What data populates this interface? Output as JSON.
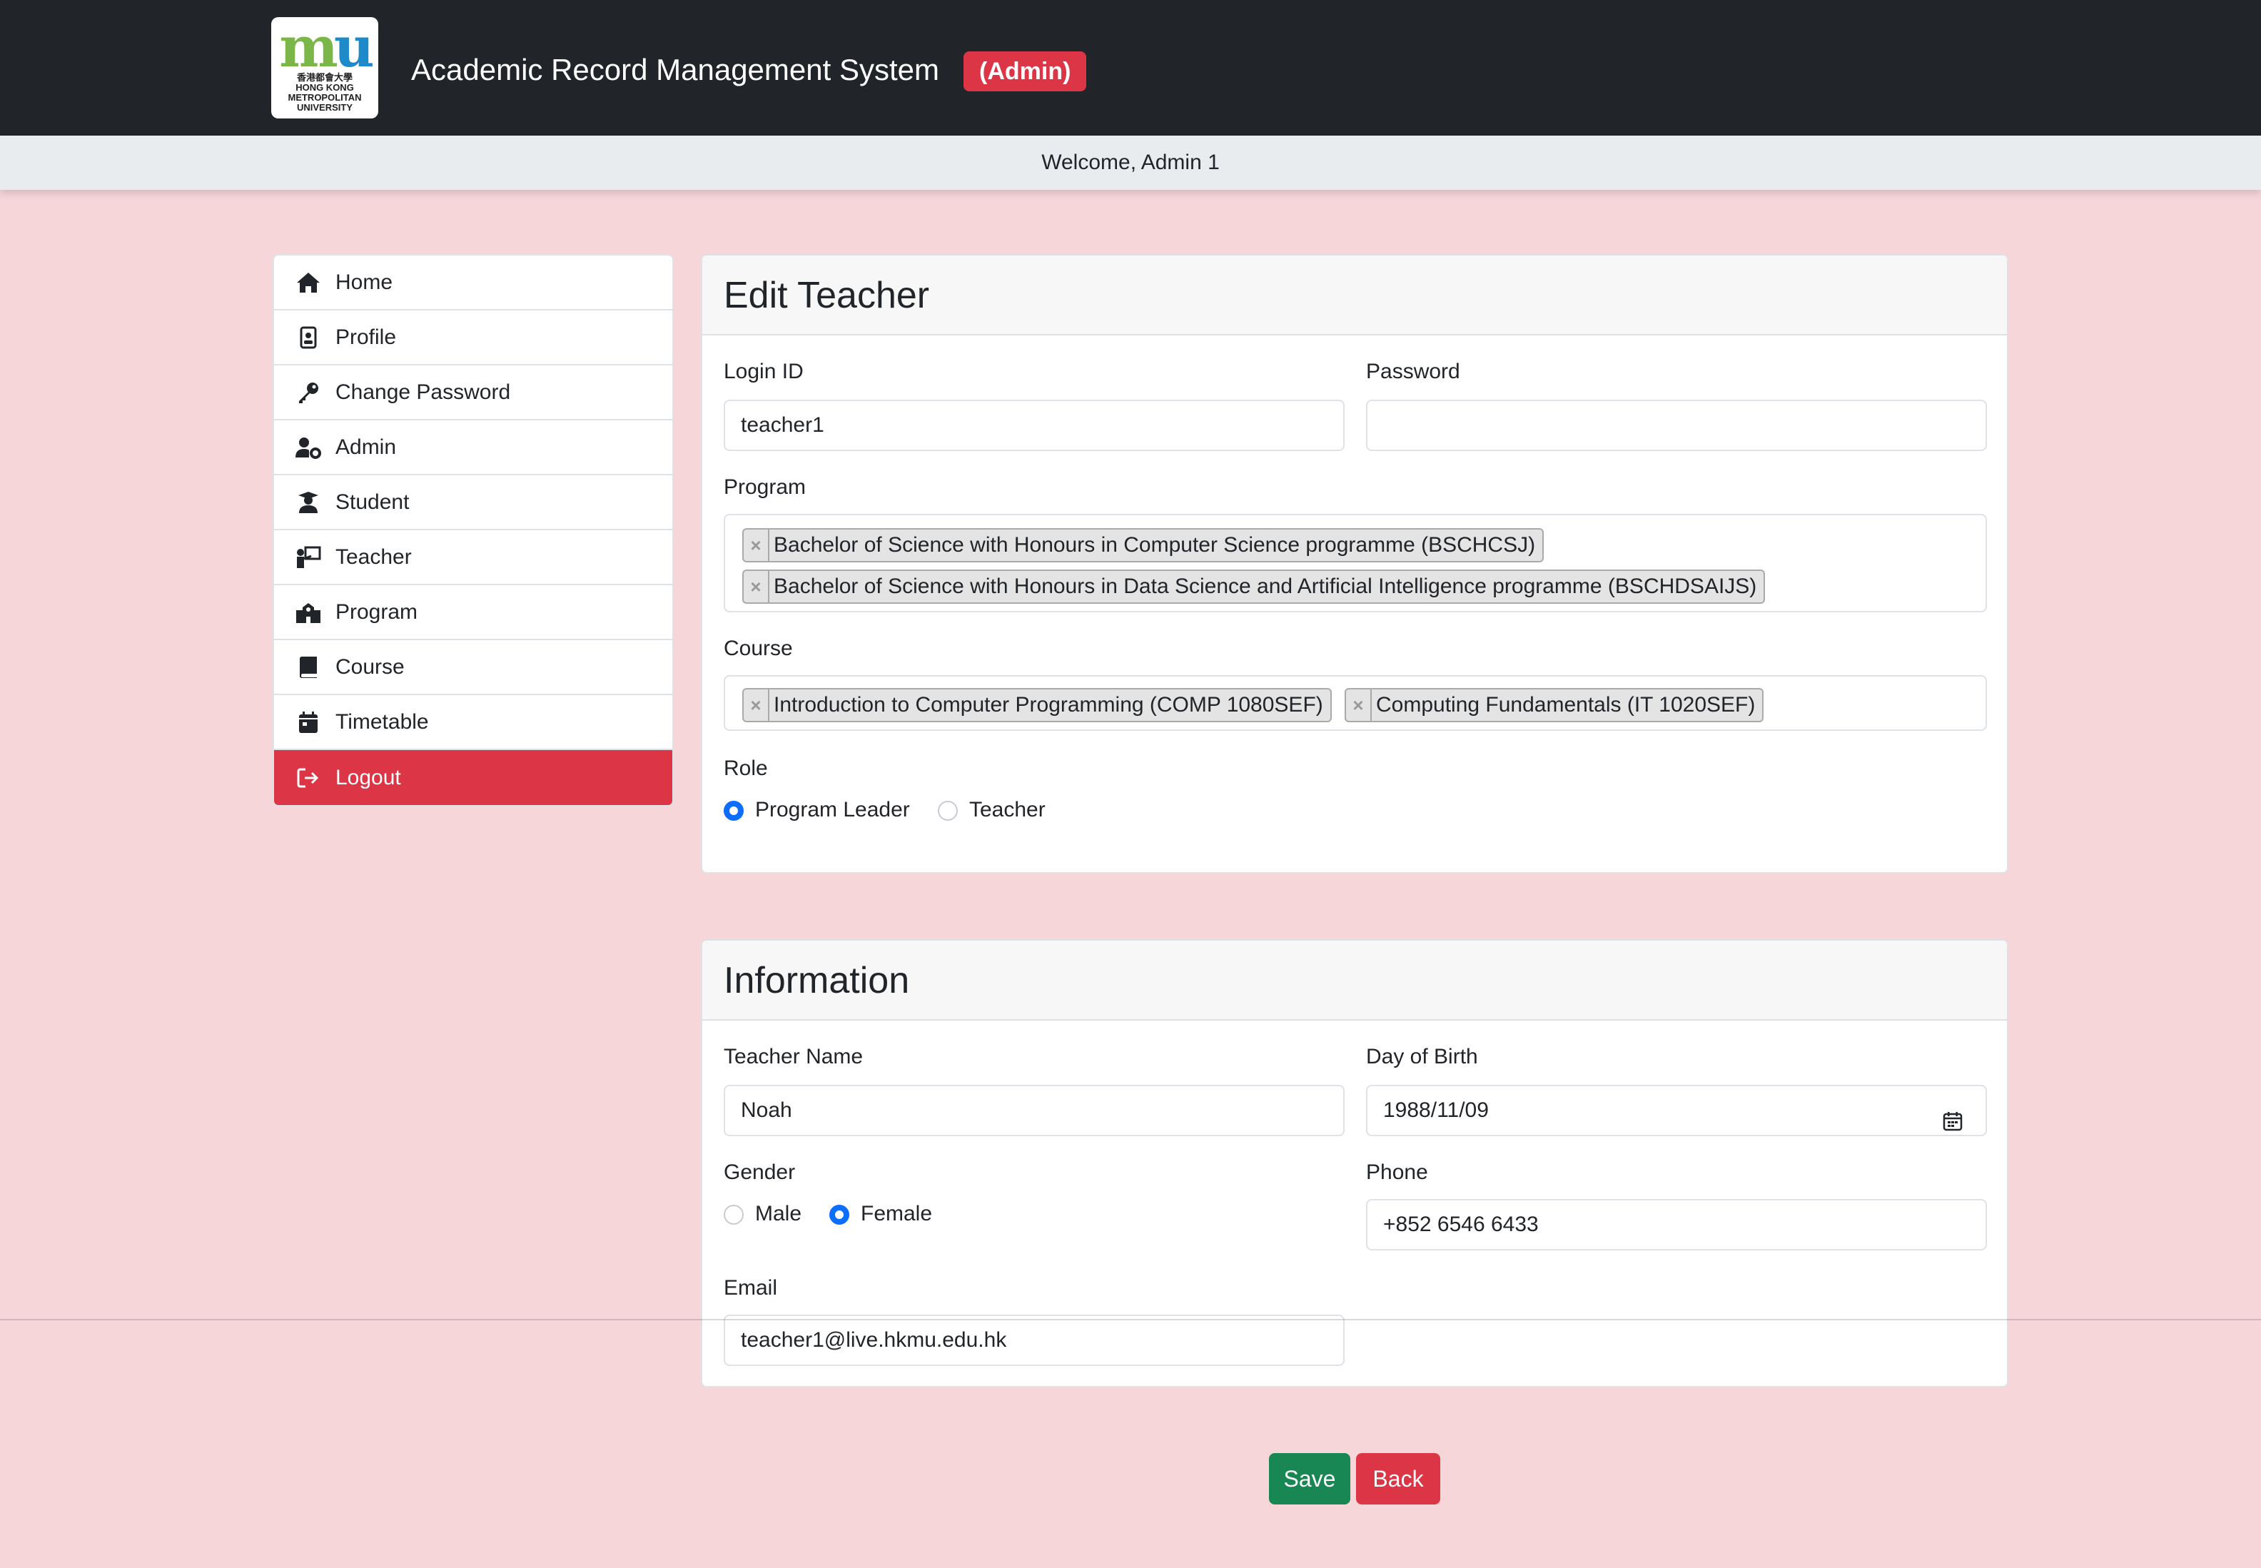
{
  "header": {
    "logo_mark_m": "m",
    "logo_mark_u": "u",
    "logo_lines": [
      "香港都會大學",
      "HONG KONG",
      "METROPOLITAN",
      "UNIVERSITY"
    ],
    "app_title": "Academic Record Management System",
    "role_badge": "(Admin)",
    "welcome": "Welcome, Admin 1"
  },
  "sidebar": {
    "items": [
      {
        "label": "Home",
        "icon": "home-icon"
      },
      {
        "label": "Profile",
        "icon": "id-badge-icon"
      },
      {
        "label": "Change Password",
        "icon": "key-icon"
      },
      {
        "label": "Admin",
        "icon": "user-gear-icon"
      },
      {
        "label": "Student",
        "icon": "user-graduate-icon"
      },
      {
        "label": "Teacher",
        "icon": "chalkboard-teacher-icon"
      },
      {
        "label": "Program",
        "icon": "school-icon"
      },
      {
        "label": "Course",
        "icon": "book-icon"
      },
      {
        "label": "Timetable",
        "icon": "calendar-icon"
      },
      {
        "label": "Logout",
        "icon": "logout-icon"
      }
    ]
  },
  "edit_teacher": {
    "title": "Edit Teacher",
    "login_id_label": "Login ID",
    "login_id_value": "teacher1",
    "password_label": "Password",
    "password_value": "",
    "program_label": "Program",
    "programs": [
      "Bachelor of Science with Honours in Computer Science programme (BSCHCSJ)",
      "Bachelor of Science with Honours in Data Science and Artificial Intelligence programme (BSCHDSAIJS)"
    ],
    "course_label": "Course",
    "courses": [
      "Introduction to Computer Programming (COMP 1080SEF)",
      "Computing Fundamentals (IT 1020SEF)"
    ],
    "role_label": "Role",
    "role_options": [
      "Program Leader",
      "Teacher"
    ],
    "role_selected": "Program Leader"
  },
  "information": {
    "title": "Information",
    "name_label": "Teacher Name",
    "name_value": "Noah",
    "dob_label": "Day of Birth",
    "dob_value": "1988/11/09",
    "gender_label": "Gender",
    "gender_options": [
      "Male",
      "Female"
    ],
    "gender_selected": "Female",
    "phone_label": "Phone",
    "phone_value": "+852 6546 6433",
    "email_label": "Email",
    "email_value": "teacher1@live.hkmu.edu.hk"
  },
  "actions": {
    "save_label": "Save",
    "back_label": "Back"
  },
  "colors": {
    "page_bg": "#f7d6da",
    "header_bg": "#212529",
    "danger": "#dc3545",
    "success": "#198754",
    "primary": "#0d6efd"
  }
}
